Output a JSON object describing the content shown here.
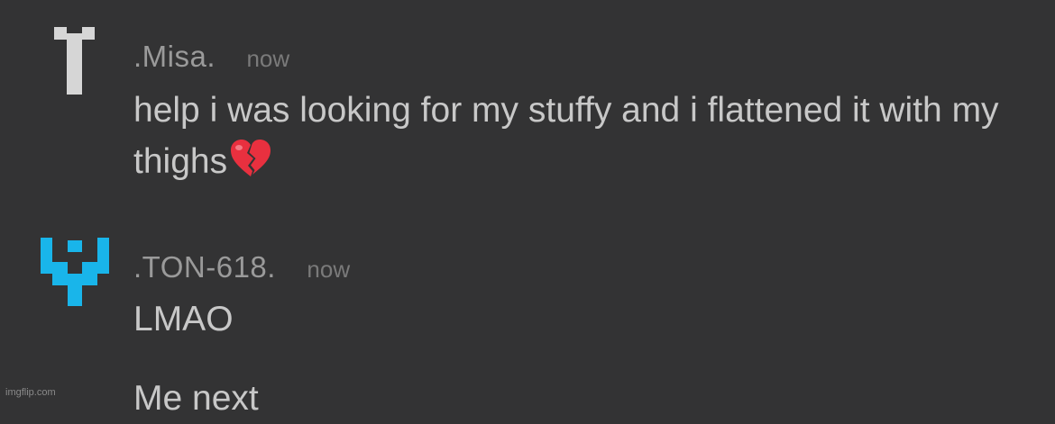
{
  "messages": [
    {
      "author": ".Misa.",
      "timestamp": "now",
      "text": "help i was looking for my stuffy and i flattened it with my thighs",
      "emoji": "broken-heart",
      "avatar_color": "#d6d6d6"
    },
    {
      "author": ".TON-618.",
      "timestamp": "now",
      "lines": [
        "LMAO",
        "Me next"
      ],
      "avatar_color": "#19b5ea"
    }
  ],
  "watermark": "imgflip.com"
}
